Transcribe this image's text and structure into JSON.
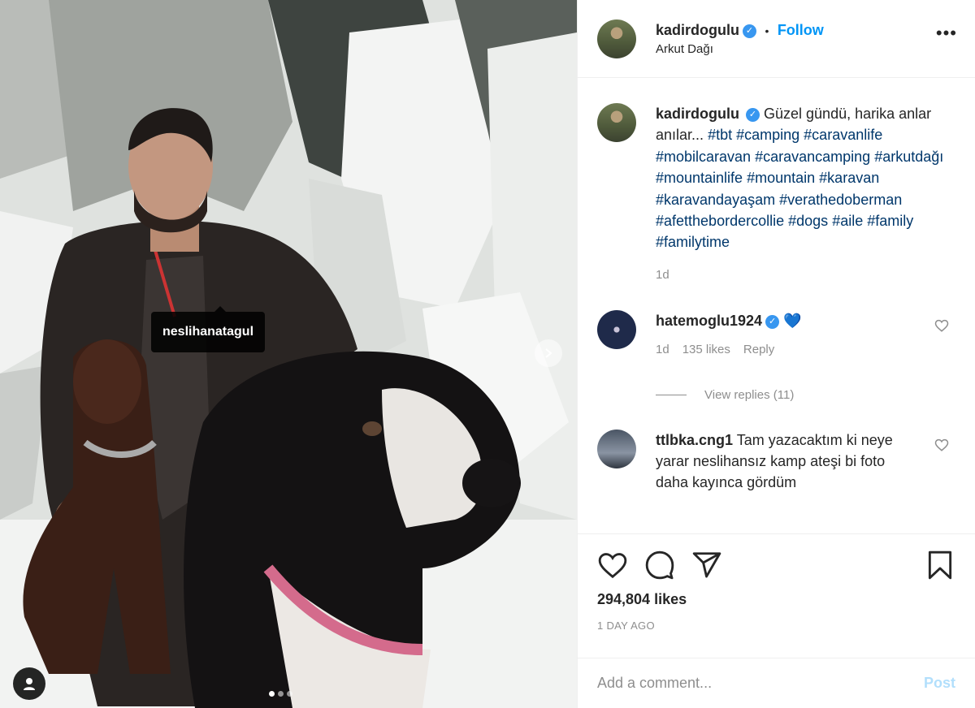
{
  "post": {
    "photo_tag": "neslihanatagul",
    "carousel": {
      "total_slides": 3,
      "active_slide": 1
    }
  },
  "header": {
    "username": "kadirdogulu",
    "bullet": "•",
    "follow_label": "Follow",
    "location": "Arkut Dağı",
    "more_label": "•••"
  },
  "caption": {
    "username": "kadirdogulu",
    "text": "Güzel gündü, harika anlar anılar...",
    "hashtags": [
      "#tbt",
      "#camping",
      "#caravanlife",
      "#mobilcaravan",
      "#caravancamping",
      "#arkutdağı",
      "#mountainlife",
      "#mountain",
      "#karavan",
      "#karavandayaşam",
      "#verathedoberman",
      "#afetthebordercollie",
      "#dogs",
      "#aile",
      "#family",
      "#familytime"
    ],
    "time": "1d"
  },
  "comments": [
    {
      "username": "hatemoglu1924",
      "emoji": "💙",
      "time": "1d",
      "likes": "135 likes",
      "reply_label": "Reply",
      "view_replies": "View replies (11)"
    },
    {
      "username": "ttlbka.cng1",
      "text": "Tam yazacaktım ki neye yarar neslihansız kamp ateşi bi foto daha kayınca gördüm"
    }
  ],
  "actions": {
    "likes": "294,804 likes",
    "date": "1 DAY AGO"
  },
  "add_comment": {
    "placeholder": "Add a comment...",
    "post_label": "Post"
  },
  "colors": {
    "link_blue": "#0095f6",
    "hashtag": "#00376b",
    "muted": "#8e8e8e",
    "verified": "#3897f0"
  },
  "icons": [
    "heart-icon",
    "comment-icon",
    "share-icon",
    "bookmark-icon",
    "more-icon",
    "verified-icon",
    "user-tag-icon",
    "chevron-right-icon",
    "blue-heart-icon"
  ]
}
